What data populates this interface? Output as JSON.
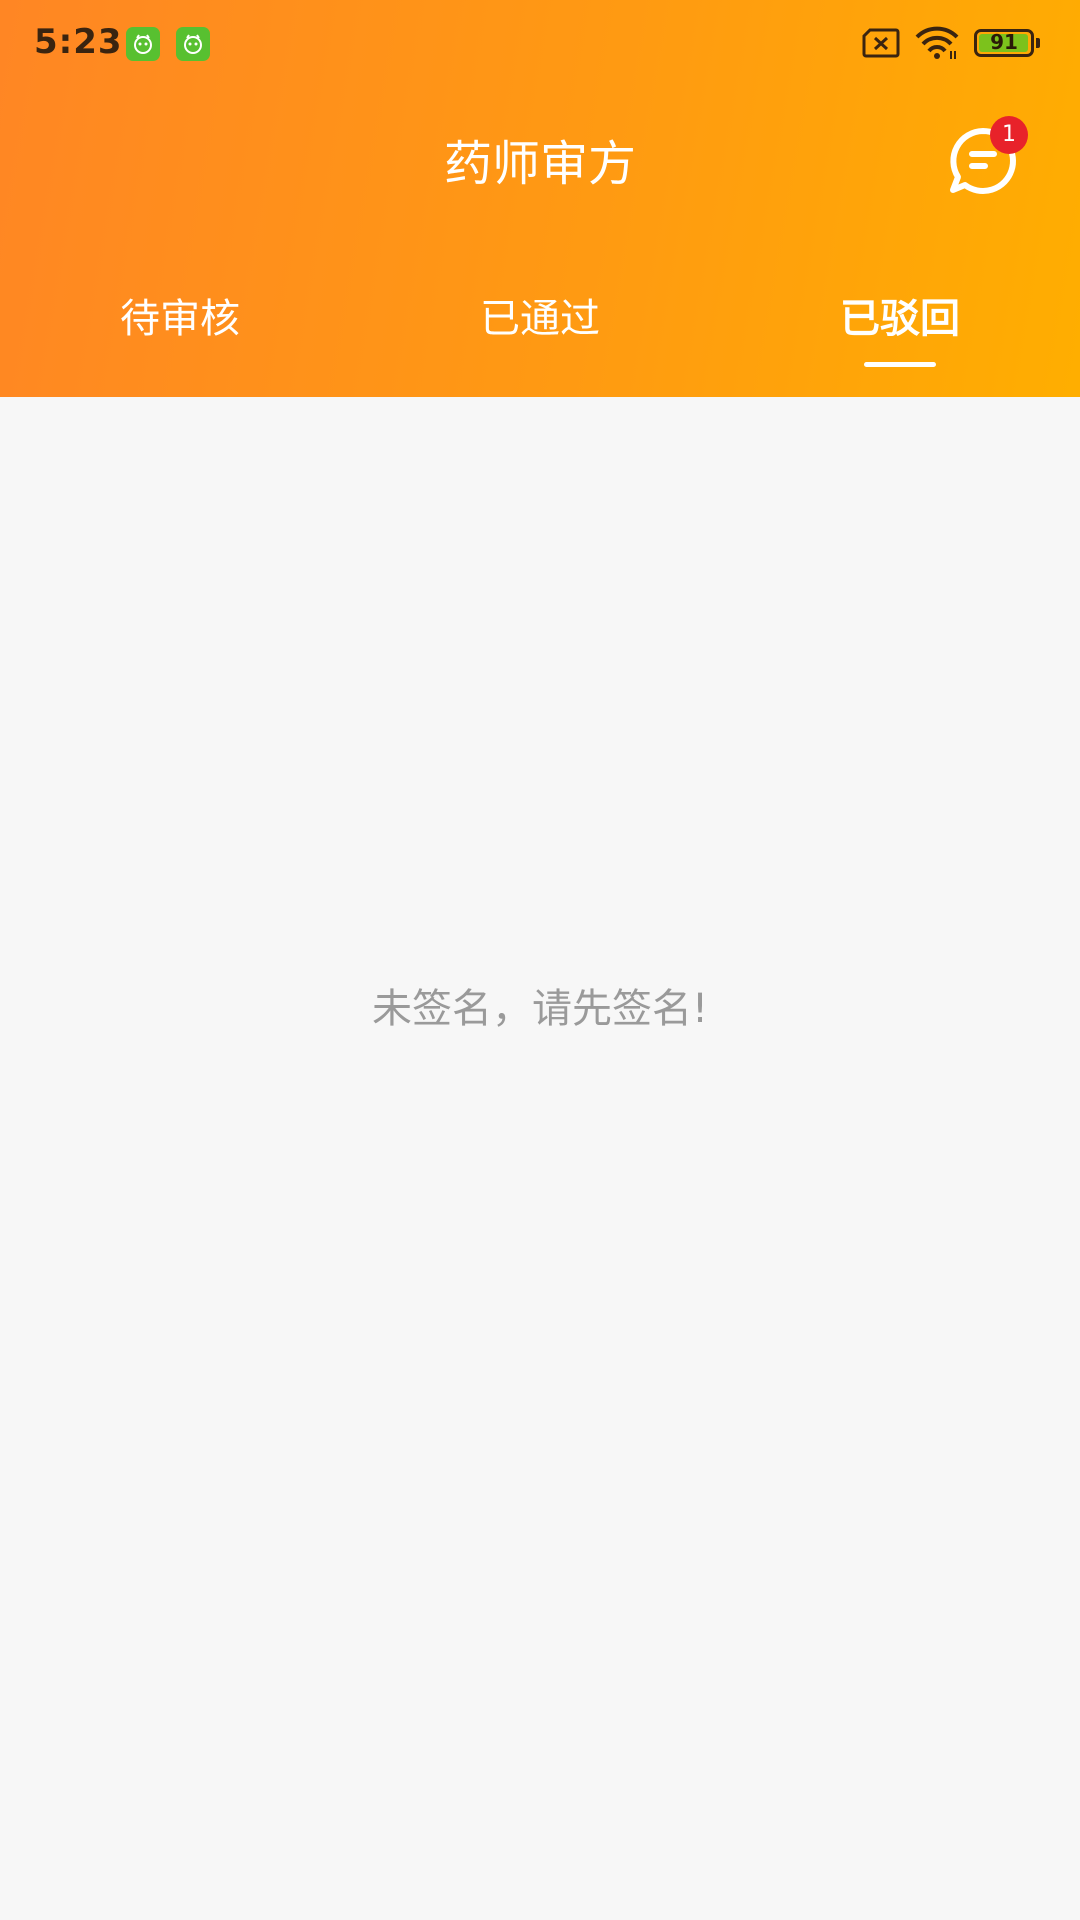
{
  "status_bar": {
    "time": "5:23",
    "battery_level": "91",
    "icons": [
      "app-notification-icon",
      "app-notification-icon",
      "no-sim-icon",
      "wifi-icon",
      "battery-icon"
    ]
  },
  "header": {
    "title": "药师审方",
    "message_icon": "chat-bubble-icon",
    "notification_count": "1"
  },
  "tabs": [
    {
      "label": "待审核",
      "active": false
    },
    {
      "label": "已通过",
      "active": false
    },
    {
      "label": "已驳回",
      "active": true
    }
  ],
  "content": {
    "empty_message": "未签名，请先签名!"
  },
  "colors": {
    "header_gradient_start": "#ff8624",
    "header_gradient_end": "#ffae00",
    "background": "#f7f7f7",
    "badge_red": "#e8222a",
    "empty_text": "#9a9a9a"
  }
}
